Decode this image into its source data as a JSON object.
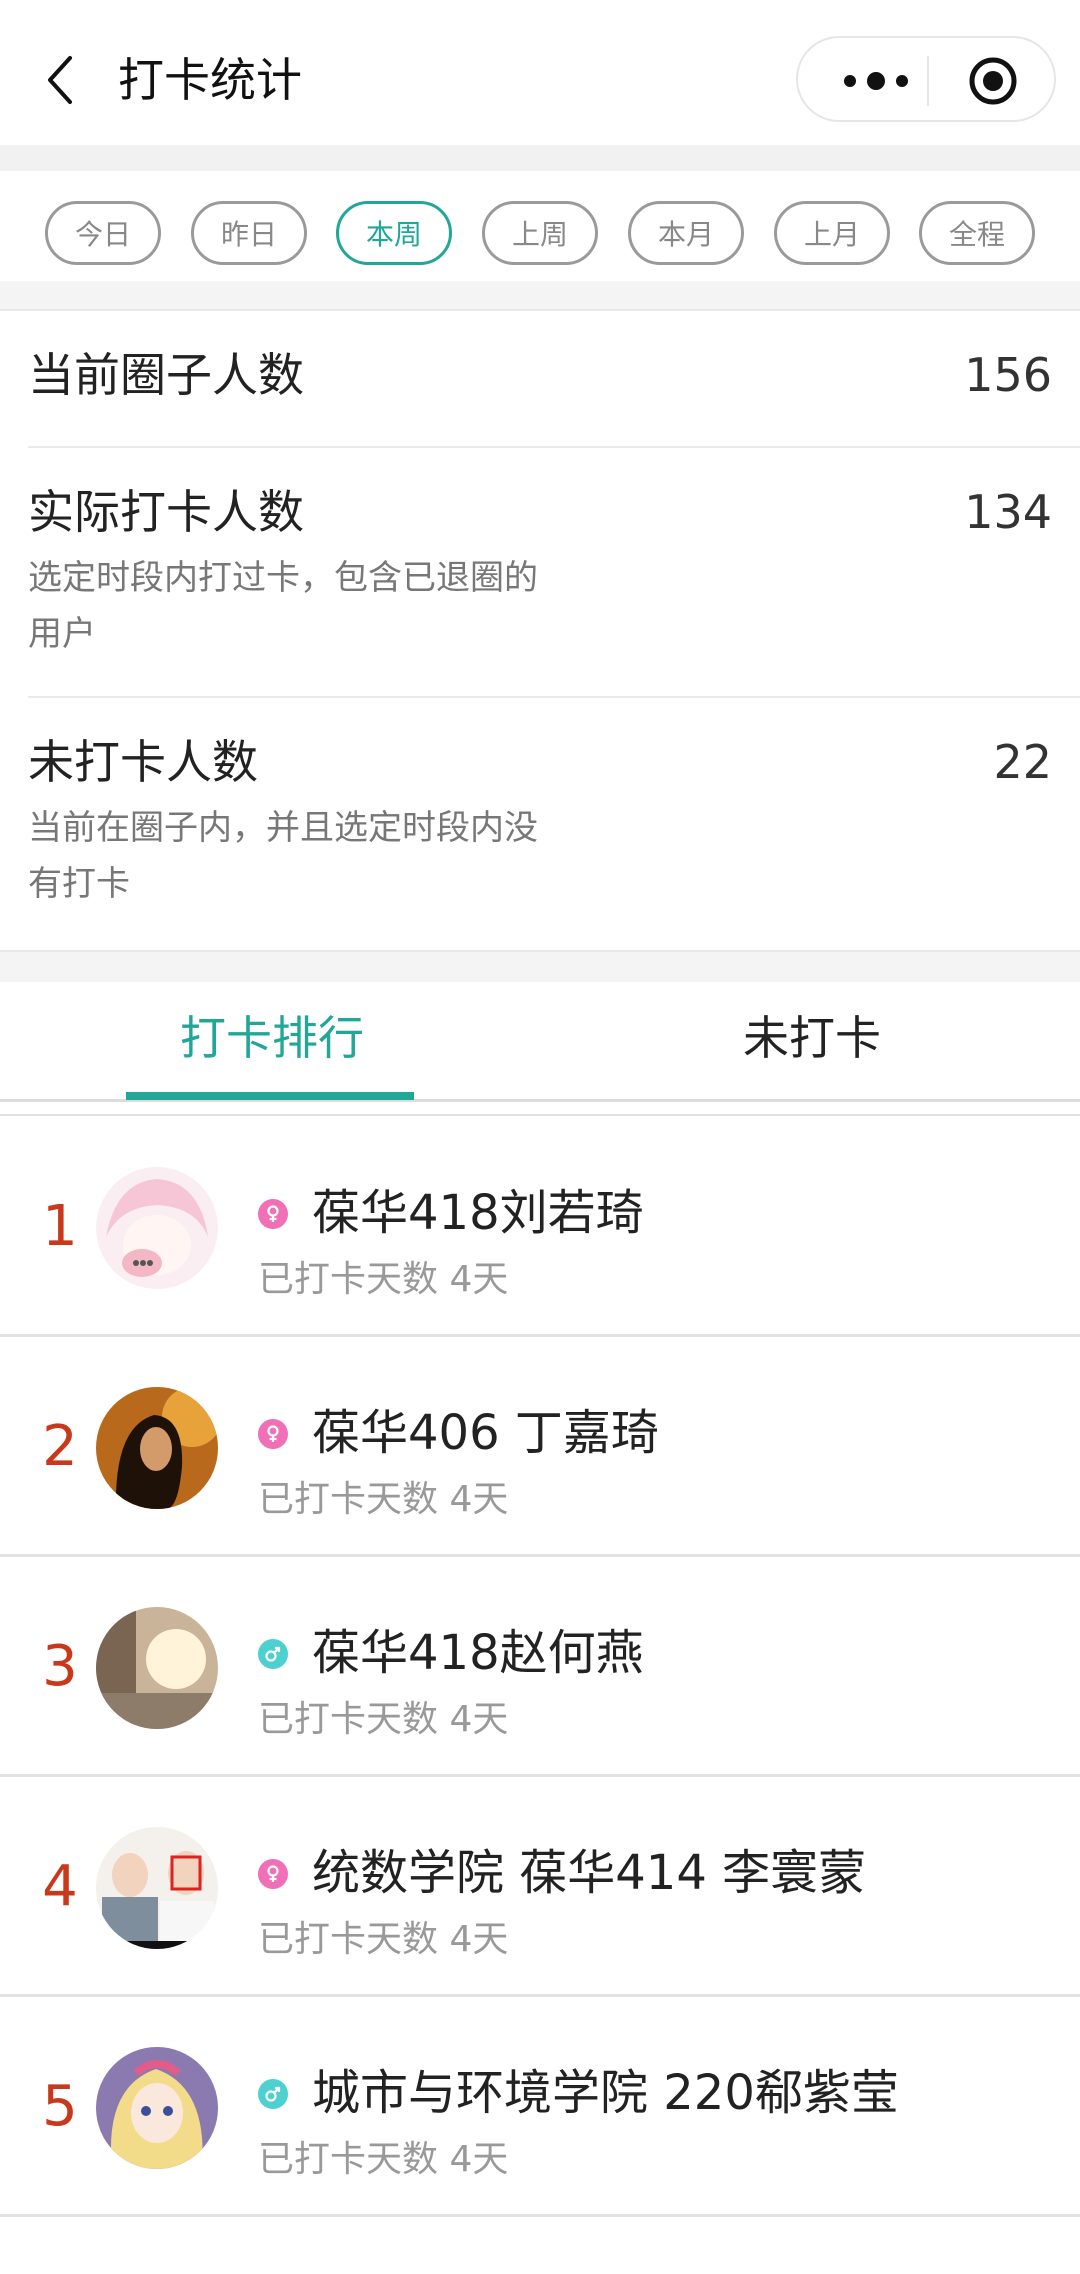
{
  "nav": {
    "title": "打卡统计"
  },
  "filters": [
    {
      "label": "今日",
      "active": false
    },
    {
      "label": "昨日",
      "active": false
    },
    {
      "label": "本周",
      "active": true
    },
    {
      "label": "上周",
      "active": false
    },
    {
      "label": "本月",
      "active": false
    },
    {
      "label": "上月",
      "active": false
    },
    {
      "label": "全程",
      "active": false
    }
  ],
  "stats": {
    "members": {
      "label": "当前圈子人数",
      "value": "156"
    },
    "checked": {
      "label": "实际打卡人数",
      "value": "134",
      "desc": "选定时段内打过卡，包含已退圈的用户"
    },
    "unchecked": {
      "label": "未打卡人数",
      "value": "22",
      "desc": "当前在圈子内，并且选定时段内没有打卡"
    }
  },
  "tabs": {
    "ranking": "打卡排行",
    "not_checked": "未打卡"
  },
  "colors": {
    "accent": "#21a797",
    "rank": "#c9381b",
    "female": "#f06fb7",
    "male": "#4dd0cf"
  },
  "ranking": [
    {
      "rank": "1",
      "gender": "female",
      "name": "葆华418刘若琦",
      "days": "已打卡天数 4天"
    },
    {
      "rank": "2",
      "gender": "female",
      "name": "葆华406 丁嘉琦",
      "days": "已打卡天数 4天"
    },
    {
      "rank": "3",
      "gender": "male",
      "name": "葆华418赵何燕",
      "days": "已打卡天数 4天"
    },
    {
      "rank": "4",
      "gender": "female",
      "name": "统数学院 葆华414 李寰蒙",
      "days": "已打卡天数 4天"
    },
    {
      "rank": "5",
      "gender": "male",
      "name": "城市与环境学院 220郗紫莹",
      "days": "已打卡天数 4天"
    }
  ]
}
